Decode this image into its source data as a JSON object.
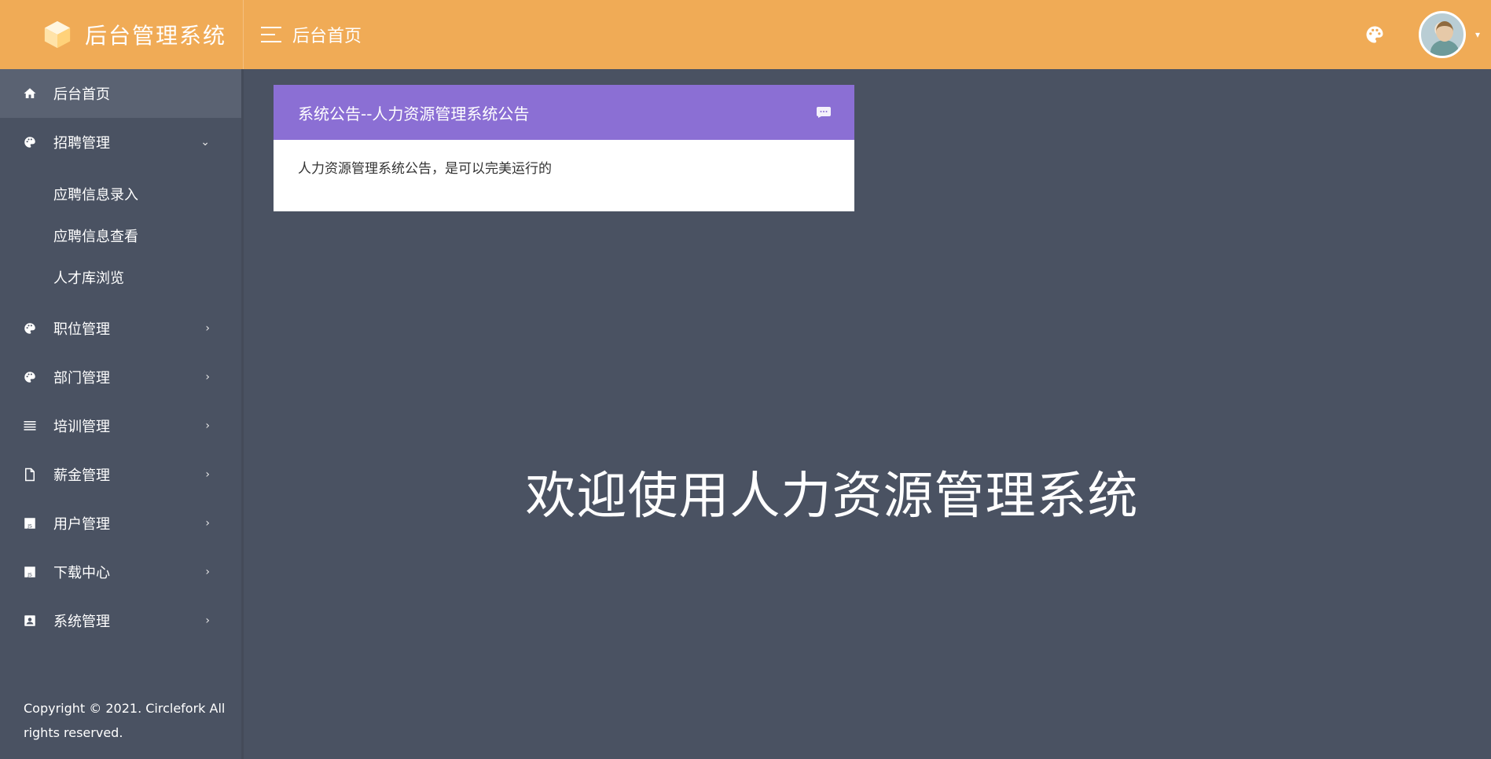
{
  "header": {
    "brand_title": "后台管理系统",
    "breadcrumb": "后台首页"
  },
  "sidebar": {
    "items": [
      {
        "label": "后台首页",
        "icon": "home-icon",
        "active": true
      },
      {
        "label": "招聘管理",
        "icon": "palette-icon",
        "expanded": true,
        "children": [
          "应聘信息录入",
          "应聘信息查看",
          "人才库浏览"
        ]
      },
      {
        "label": "职位管理",
        "icon": "palette-icon"
      },
      {
        "label": "部门管理",
        "icon": "palette-icon"
      },
      {
        "label": "培训管理",
        "icon": "list-icon"
      },
      {
        "label": "薪金管理",
        "icon": "file-icon"
      },
      {
        "label": "用户管理",
        "icon": "js-file-icon"
      },
      {
        "label": "下载中心",
        "icon": "js-file-icon"
      },
      {
        "label": "系统管理",
        "icon": "contact-card-icon"
      }
    ],
    "copyright": "Copyright © 2021. Circlefork All rights reserved."
  },
  "notice": {
    "title": "系统公告--人力资源管理系统公告",
    "body": "人力资源管理系统公告，是可以完美运行的"
  },
  "welcome_text": "欢迎使用人力资源管理系统",
  "colors": {
    "topbar": "#f0ab56",
    "sidebar": "#4a5262",
    "content_bg": "#4a5262",
    "notice_header": "#8b6fd4"
  }
}
